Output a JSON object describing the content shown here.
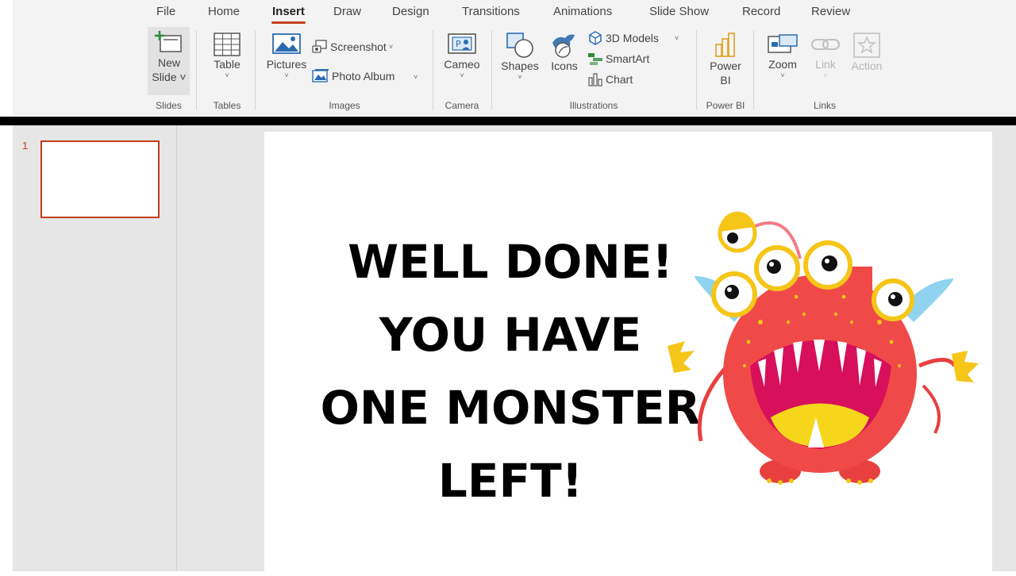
{
  "ribbon": {
    "tabs": [
      {
        "label": "File"
      },
      {
        "label": "Home"
      },
      {
        "label": "Insert",
        "active": true
      },
      {
        "label": "Draw"
      },
      {
        "label": "Design"
      },
      {
        "label": "Transitions"
      },
      {
        "label": "Animations"
      },
      {
        "label": "Slide Show"
      },
      {
        "label": "Record"
      },
      {
        "label": "Review"
      }
    ],
    "slides": {
      "new_slide_line1": "New",
      "new_slide_line2": "Slide",
      "group": "Slides"
    },
    "tables": {
      "table": "Table",
      "group": "Tables"
    },
    "images": {
      "pictures": "Pictures",
      "screenshot": "Screenshot",
      "photo_album": "Photo Album",
      "group": "Images"
    },
    "camera": {
      "cameo": "Cameo",
      "group": "Camera"
    },
    "illustrations": {
      "shapes": "Shapes",
      "icons": "Icons",
      "models_3d": "3D Models",
      "smartart": "SmartArt",
      "chart": "Chart",
      "group": "Illustrations"
    },
    "powerbi": {
      "line1": "Power",
      "line2": "BI",
      "group": "Power BI"
    },
    "links": {
      "zoom": "Zoom",
      "link": "Link",
      "action": "Action",
      "group": "Links"
    }
  },
  "thumbnails": {
    "slide_number": "1"
  },
  "slide": {
    "lines": [
      "WELL DONE!",
      "YOU HAVE",
      "ONE MONSTER",
      "LEFT!"
    ]
  },
  "colors": {
    "accent": "#c43e1c",
    "ribbon_bg": "#f3f3f3",
    "pane_bg": "#e6e6e6"
  }
}
